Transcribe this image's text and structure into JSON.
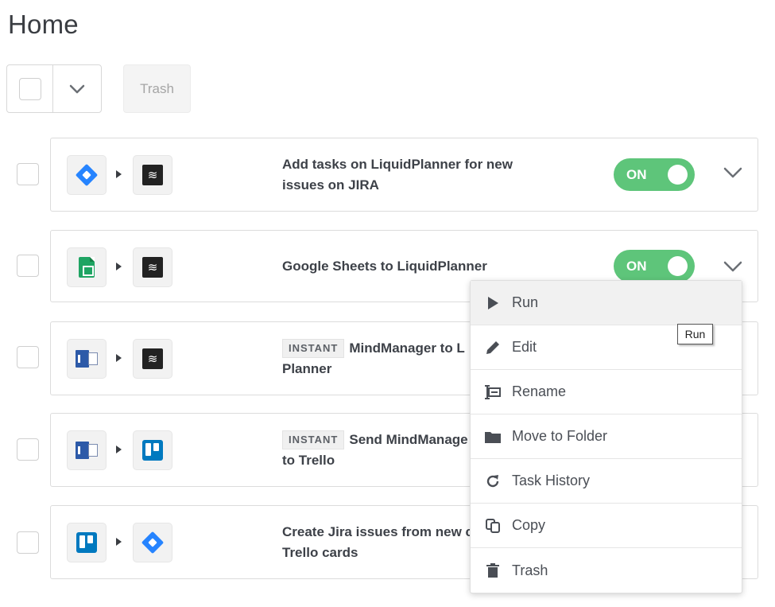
{
  "page": {
    "title": "Home"
  },
  "toolbar": {
    "trash_label": "Trash"
  },
  "zaps": [
    {
      "trigger_app": "jira-icon",
      "action_app": "liquidplanner-icon",
      "instant": false,
      "title_line1": "Add tasks on LiquidPlanner for new",
      "title_line2": "issues on JIRA",
      "toggle": "ON"
    },
    {
      "trigger_app": "google-sheets-icon",
      "action_app": "liquidplanner-icon",
      "instant": false,
      "title_line1": "Google Sheets to LiquidPlanner",
      "title_line2": "",
      "toggle": "ON"
    },
    {
      "trigger_app": "mindmanager-icon",
      "action_app": "liquidplanner-icon",
      "instant": true,
      "badge": "INSTANT",
      "title_line1": "MindManager to L",
      "title_line2": "Planner"
    },
    {
      "trigger_app": "mindmanager-icon",
      "action_app": "trello-icon",
      "instant": true,
      "badge": "INSTANT",
      "title_line1": "Send MindManage",
      "title_line2": "to Trello"
    },
    {
      "trigger_app": "trello-icon",
      "action_app": "jira-icon",
      "instant": false,
      "title_line1": "Create Jira issues from new c",
      "title_line2": "Trello cards"
    }
  ],
  "menu": {
    "items": [
      {
        "label": "Run",
        "icon": "play-icon"
      },
      {
        "label": "Edit",
        "icon": "pencil-icon"
      },
      {
        "label": "Rename",
        "icon": "rename-icon"
      },
      {
        "label": "Move to Folder",
        "icon": "folder-icon"
      },
      {
        "label": "Task History",
        "icon": "history-icon"
      },
      {
        "label": "Copy",
        "icon": "copy-icon"
      },
      {
        "label": "Trash",
        "icon": "trash-icon"
      }
    ]
  },
  "tooltip": {
    "text": "Run"
  },
  "colors": {
    "toggle_on": "#5ec57a",
    "jira": "#2684ff",
    "trello": "#0079bf",
    "sheets": "#1fa463",
    "mindmanager": "#2d5aa8"
  }
}
